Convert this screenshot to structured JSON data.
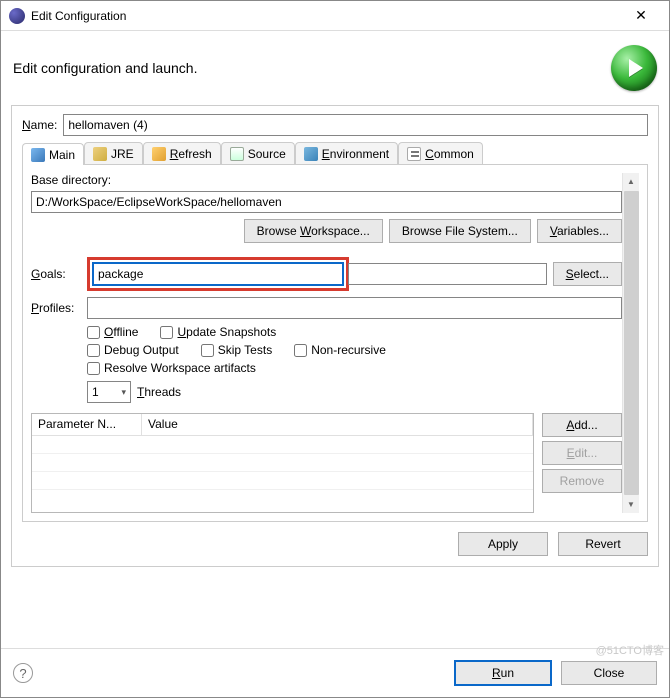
{
  "window": {
    "title": "Edit Configuration",
    "headline": "Edit configuration and launch."
  },
  "name_field": {
    "label": "Name:",
    "value": "hellomaven (4)"
  },
  "tabs": {
    "main": "Main",
    "jre": "JRE",
    "refresh": "Refresh",
    "source": "Source",
    "environment": "Environment",
    "common": "Common"
  },
  "main_tab": {
    "base_dir_label": "Base directory:",
    "base_dir_value": "D:/WorkSpace/EclipseWorkSpace/hellomaven",
    "browse_workspace": "Browse Workspace...",
    "browse_filesystem": "Browse File System...",
    "variables": "Variables...",
    "goals_label": "Goals:",
    "goals_value": "package",
    "select": "Select...",
    "profiles_label": "Profiles:",
    "profiles_value": "",
    "offline": "Offline",
    "update_snapshots": "Update Snapshots",
    "debug_output": "Debug Output",
    "skip_tests": "Skip Tests",
    "non_recursive": "Non-recursive",
    "resolve_workspace": "Resolve Workspace artifacts",
    "threads_value": "1",
    "threads_label": "Threads",
    "param_header_name": "Parameter N...",
    "param_header_value": "Value",
    "add": "Add...",
    "edit": "Edit...",
    "remove": "Remove"
  },
  "bottom": {
    "apply": "Apply",
    "revert": "Revert"
  },
  "footer": {
    "run": "Run",
    "close": "Close"
  },
  "watermark": "@51CTO博客"
}
